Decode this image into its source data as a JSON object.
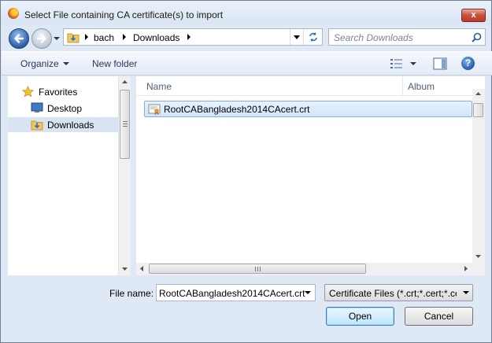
{
  "window": {
    "title": "Select File containing CA certificate(s) to import"
  },
  "titlebar": {
    "close_glyph": "x"
  },
  "address": {
    "crumbs": [
      "bach",
      "Downloads"
    ]
  },
  "search": {
    "placeholder": "Search Downloads"
  },
  "toolbar": {
    "organize_label": "Organize",
    "new_folder_label": "New folder",
    "help_glyph": "?"
  },
  "sidebar": {
    "items": [
      {
        "label": "Favorites",
        "icon": "star-icon"
      },
      {
        "label": "Desktop",
        "icon": "desktop-icon"
      },
      {
        "label": "Downloads",
        "icon": "downloads-folder-icon",
        "selected": true
      }
    ]
  },
  "filelist": {
    "columns": [
      "Name",
      "Album"
    ],
    "files": [
      {
        "name": "RootCABangladesh2014CAcert.crt",
        "icon": "certificate-icon",
        "selected": true
      }
    ]
  },
  "bottom": {
    "filename_label": "File name:",
    "filename_value": "RootCABangladesh2014CAcert.crt",
    "filter_value": "Certificate Files (*.crt;*.cert;*.ce",
    "open_label": "Open",
    "cancel_label": "Cancel"
  },
  "colors": {
    "accent": "#3c7fb1",
    "selection": "#d2e4fb",
    "chrome": "#dfe9f5"
  }
}
